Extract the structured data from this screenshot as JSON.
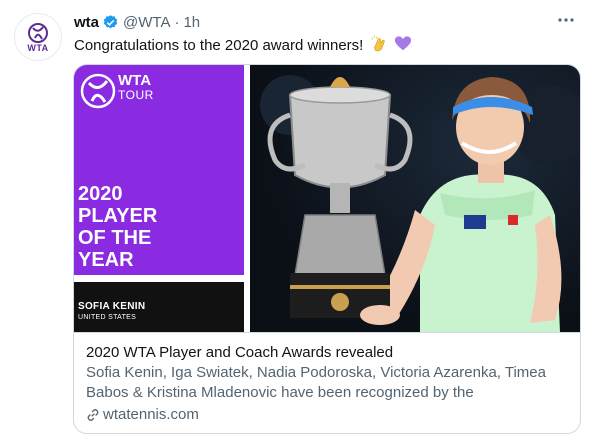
{
  "tweet": {
    "display_name": "wta",
    "handle": "@WTA",
    "separator": "·",
    "time": "1h",
    "text": "Congratulations to the 2020  award winners!",
    "emojis": [
      "clapping-hands",
      "purple-heart"
    ],
    "avatar_label": "WTA"
  },
  "card": {
    "image": {
      "logo_title": "WTA",
      "logo_subtitle": "TOUR",
      "headline": "2020\nPLAYER\nOF THE\nYEAR",
      "player_name": "SOFIA KENIN",
      "player_country": "UNITED STATES"
    },
    "title": "2020 WTA Player and Coach Awards revealed",
    "description": "Sofia Kenin, Iga Swiatek, Nadia Podoroska, Victoria Azarenka, Timea Babos & Kristina Mladenovic have been recognized by the international…",
    "domain": "wtatennis.com"
  },
  "colors": {
    "brand_purple": "#8a2be2",
    "verified_blue": "#1d9bf0"
  }
}
